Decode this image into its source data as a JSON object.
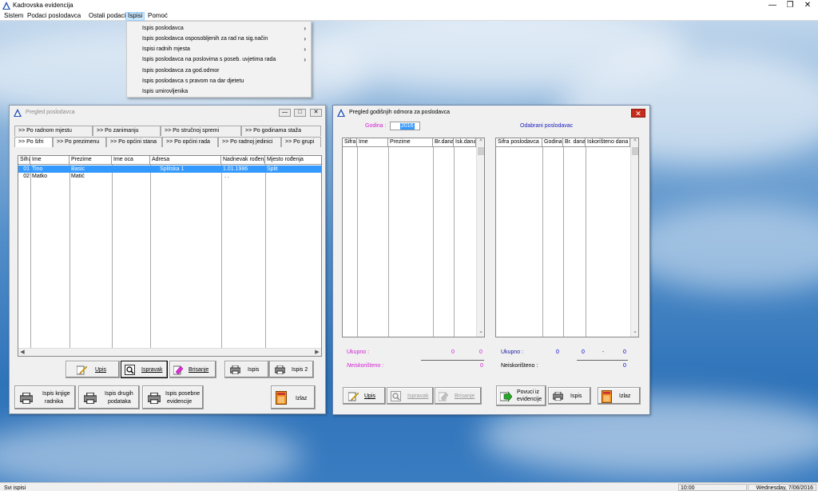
{
  "app": {
    "title": "Kadrovska evidencija"
  },
  "menu": {
    "items": [
      "Sistem",
      "Podaci poslodavca",
      "Ostali podaci",
      "Ispisi",
      "Pomoć"
    ],
    "active": "Ispisi"
  },
  "dropdown": {
    "items": [
      "Ispis poslodavca",
      "Ispis poslodavca osposobljenih za rad na sig.način",
      "Ispisi radnih mjesta",
      "Ispis poslodavca na poslovima s poseb. uvjetima rada",
      "Ispis poslodavca za god.odmor",
      "Ispis poslodavca s pravom na dar djetetu",
      "Ispis umirovljenika"
    ]
  },
  "left_window": {
    "title": "Pregled poslodavca",
    "tabs_row1": [
      ">> Po radnom mjestu",
      ">> Po zanimanju",
      ">> Po stručnoj spremi",
      ">> Po godinama staža"
    ],
    "tabs_row2": [
      ">> Po šifri",
      ">> Po prezimenu",
      ">> Po općini stana",
      ">> Po općini rada",
      ">> Po  radnoj jedinici",
      ">> Po grupi"
    ],
    "columns": [
      "Šifra",
      "Ime",
      "Prezime",
      "Ime oca",
      "Adresa",
      "Nadnevak rođenja",
      "Mjesto rođenja"
    ],
    "rows": [
      [
        "01",
        "Tino",
        "Basic",
        "",
        "Splitska 1",
        "1.01.1986",
        "Split"
      ],
      [
        "02",
        "Matko",
        "Matić",
        "",
        "",
        ". .",
        ""
      ]
    ],
    "buttons": {
      "upis": "Upis",
      "ispravak": "Ispravak",
      "brisanje": "Brisanje",
      "ispis": "Ispis",
      "ispis2": "Ispis 2",
      "knjiga_l1": "Ispis knjige",
      "knjiga_l2": "radnika",
      "drugi_l1": "Ispis drugih",
      "drugi_l2": "podataka",
      "posebne_l1": "Ispis posebne",
      "posebne_l2": "evidencije",
      "izlaz": "Izlaz"
    }
  },
  "right_window": {
    "title": "Pregled godišnjih odmora za poslodavca",
    "godina_label": "Godina :",
    "godina_value": "2016",
    "odabrani_label": "Odabrani poslodavac",
    "left_columns": [
      "Šifra",
      "Ime",
      "Prezime",
      "Br.dana",
      "Isk.dana"
    ],
    "right_columns": [
      "Šifra poslodavca",
      "Godina",
      "Br. dana",
      "Iskorišteno dana"
    ],
    "ukupno_label": "Ukupno :",
    "neiskoristeno_label": "Neiskorišteno :",
    "left_totals": {
      "br": "0",
      "isk": "0",
      "neisk": "0"
    },
    "right_totals": {
      "godina": "0",
      "br": "0",
      "dash": "-",
      "isk": "0",
      "neisk": "0"
    },
    "buttons": {
      "upis": "Upis",
      "ispravak": "Ispravak",
      "brisanje": "Brisanje",
      "povuci_l1": "Povuci iz",
      "povuci_l2": "evidencije",
      "ispis": "Ispis",
      "izlaz": "Izlaz"
    }
  },
  "statusbar": {
    "left": "Svi ispisi",
    "time": "10:00",
    "date": "Wednesday,  7/06/2016"
  },
  "colors": {
    "selection": "#3399ff",
    "accent_label": "#d11fd1",
    "value_blue": "#0000cc",
    "close": "#c42b1c"
  }
}
